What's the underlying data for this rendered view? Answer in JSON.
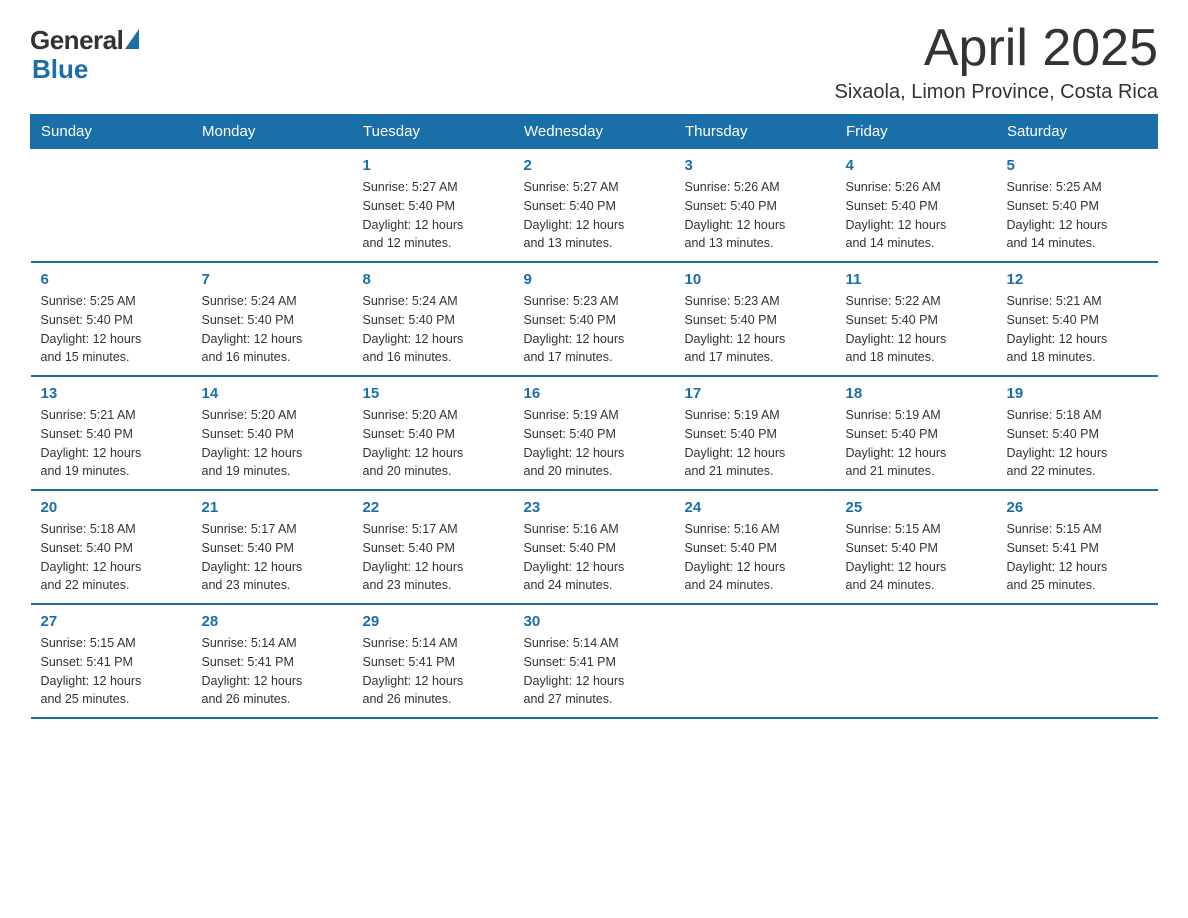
{
  "header": {
    "logo": {
      "general": "General",
      "blue": "Blue"
    },
    "title": "April 2025",
    "location": "Sixaola, Limon Province, Costa Rica"
  },
  "calendar": {
    "days_of_week": [
      "Sunday",
      "Monday",
      "Tuesday",
      "Wednesday",
      "Thursday",
      "Friday",
      "Saturday"
    ],
    "weeks": [
      [
        {
          "day": "",
          "info": ""
        },
        {
          "day": "",
          "info": ""
        },
        {
          "day": "1",
          "info": "Sunrise: 5:27 AM\nSunset: 5:40 PM\nDaylight: 12 hours\nand 12 minutes."
        },
        {
          "day": "2",
          "info": "Sunrise: 5:27 AM\nSunset: 5:40 PM\nDaylight: 12 hours\nand 13 minutes."
        },
        {
          "day": "3",
          "info": "Sunrise: 5:26 AM\nSunset: 5:40 PM\nDaylight: 12 hours\nand 13 minutes."
        },
        {
          "day": "4",
          "info": "Sunrise: 5:26 AM\nSunset: 5:40 PM\nDaylight: 12 hours\nand 14 minutes."
        },
        {
          "day": "5",
          "info": "Sunrise: 5:25 AM\nSunset: 5:40 PM\nDaylight: 12 hours\nand 14 minutes."
        }
      ],
      [
        {
          "day": "6",
          "info": "Sunrise: 5:25 AM\nSunset: 5:40 PM\nDaylight: 12 hours\nand 15 minutes."
        },
        {
          "day": "7",
          "info": "Sunrise: 5:24 AM\nSunset: 5:40 PM\nDaylight: 12 hours\nand 16 minutes."
        },
        {
          "day": "8",
          "info": "Sunrise: 5:24 AM\nSunset: 5:40 PM\nDaylight: 12 hours\nand 16 minutes."
        },
        {
          "day": "9",
          "info": "Sunrise: 5:23 AM\nSunset: 5:40 PM\nDaylight: 12 hours\nand 17 minutes."
        },
        {
          "day": "10",
          "info": "Sunrise: 5:23 AM\nSunset: 5:40 PM\nDaylight: 12 hours\nand 17 minutes."
        },
        {
          "day": "11",
          "info": "Sunrise: 5:22 AM\nSunset: 5:40 PM\nDaylight: 12 hours\nand 18 minutes."
        },
        {
          "day": "12",
          "info": "Sunrise: 5:21 AM\nSunset: 5:40 PM\nDaylight: 12 hours\nand 18 minutes."
        }
      ],
      [
        {
          "day": "13",
          "info": "Sunrise: 5:21 AM\nSunset: 5:40 PM\nDaylight: 12 hours\nand 19 minutes."
        },
        {
          "day": "14",
          "info": "Sunrise: 5:20 AM\nSunset: 5:40 PM\nDaylight: 12 hours\nand 19 minutes."
        },
        {
          "day": "15",
          "info": "Sunrise: 5:20 AM\nSunset: 5:40 PM\nDaylight: 12 hours\nand 20 minutes."
        },
        {
          "day": "16",
          "info": "Sunrise: 5:19 AM\nSunset: 5:40 PM\nDaylight: 12 hours\nand 20 minutes."
        },
        {
          "day": "17",
          "info": "Sunrise: 5:19 AM\nSunset: 5:40 PM\nDaylight: 12 hours\nand 21 minutes."
        },
        {
          "day": "18",
          "info": "Sunrise: 5:19 AM\nSunset: 5:40 PM\nDaylight: 12 hours\nand 21 minutes."
        },
        {
          "day": "19",
          "info": "Sunrise: 5:18 AM\nSunset: 5:40 PM\nDaylight: 12 hours\nand 22 minutes."
        }
      ],
      [
        {
          "day": "20",
          "info": "Sunrise: 5:18 AM\nSunset: 5:40 PM\nDaylight: 12 hours\nand 22 minutes."
        },
        {
          "day": "21",
          "info": "Sunrise: 5:17 AM\nSunset: 5:40 PM\nDaylight: 12 hours\nand 23 minutes."
        },
        {
          "day": "22",
          "info": "Sunrise: 5:17 AM\nSunset: 5:40 PM\nDaylight: 12 hours\nand 23 minutes."
        },
        {
          "day": "23",
          "info": "Sunrise: 5:16 AM\nSunset: 5:40 PM\nDaylight: 12 hours\nand 24 minutes."
        },
        {
          "day": "24",
          "info": "Sunrise: 5:16 AM\nSunset: 5:40 PM\nDaylight: 12 hours\nand 24 minutes."
        },
        {
          "day": "25",
          "info": "Sunrise: 5:15 AM\nSunset: 5:40 PM\nDaylight: 12 hours\nand 24 minutes."
        },
        {
          "day": "26",
          "info": "Sunrise: 5:15 AM\nSunset: 5:41 PM\nDaylight: 12 hours\nand 25 minutes."
        }
      ],
      [
        {
          "day": "27",
          "info": "Sunrise: 5:15 AM\nSunset: 5:41 PM\nDaylight: 12 hours\nand 25 minutes."
        },
        {
          "day": "28",
          "info": "Sunrise: 5:14 AM\nSunset: 5:41 PM\nDaylight: 12 hours\nand 26 minutes."
        },
        {
          "day": "29",
          "info": "Sunrise: 5:14 AM\nSunset: 5:41 PM\nDaylight: 12 hours\nand 26 minutes."
        },
        {
          "day": "30",
          "info": "Sunrise: 5:14 AM\nSunset: 5:41 PM\nDaylight: 12 hours\nand 27 minutes."
        },
        {
          "day": "",
          "info": ""
        },
        {
          "day": "",
          "info": ""
        },
        {
          "day": "",
          "info": ""
        }
      ]
    ]
  }
}
